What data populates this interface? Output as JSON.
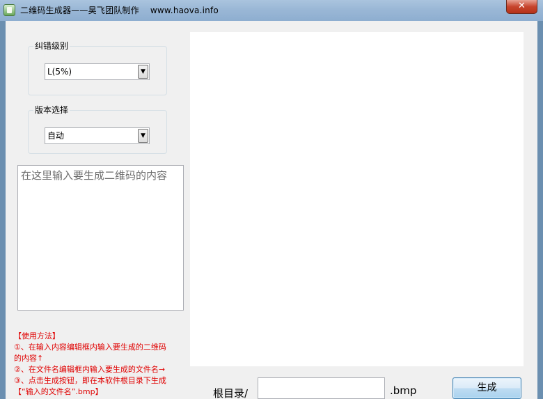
{
  "window": {
    "title": "二维码生成器——昊飞团队制作    www.haova.info",
    "close_symbol": "✕"
  },
  "error_level": {
    "legend": "纠错级别",
    "selected": "L(5%)"
  },
  "version": {
    "legend": "版本选择",
    "selected": "自动"
  },
  "content_input": {
    "placeholder": "在这里输入要生成二维码的内容"
  },
  "help": {
    "lines": [
      "【使用方法】",
      "①、在输入内容编辑框内输入要生成的二维码",
      "的内容↑",
      "②、在文件名编辑框内输入要生成的文件名→",
      "③、点击生成按钮，即在本软件根目录下生成",
      "【“输入的文件名”.bmp】"
    ]
  },
  "footer": {
    "root_label": "根目录/",
    "filename_value": "",
    "extension_label": ".bmp",
    "generate_label": "生成"
  },
  "icons": {
    "app": "app-icon",
    "dropdown": "chevron-down-icon"
  }
}
